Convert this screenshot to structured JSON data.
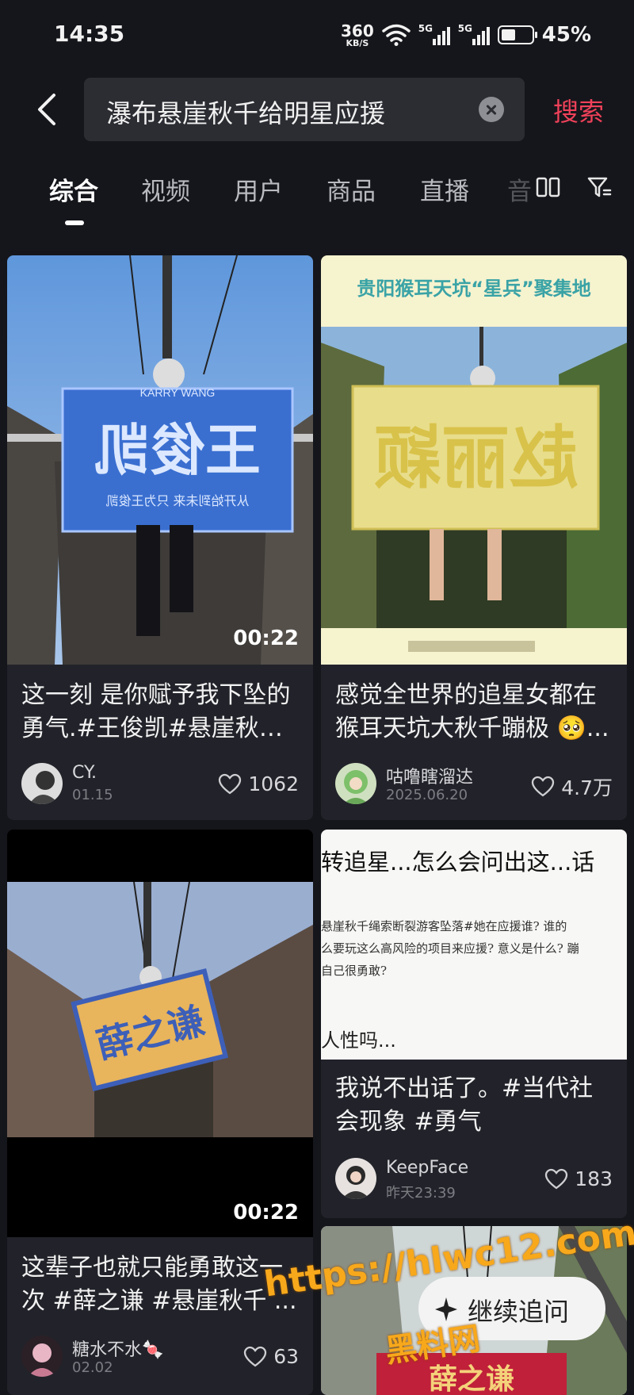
{
  "status_bar": {
    "time": "14:35",
    "net_speed": "360",
    "net_unit": "KB/S",
    "sim1": "5G",
    "sim2": "5G",
    "battery_text": "45%",
    "battery_level": 0.45
  },
  "search": {
    "query": "瀑布悬崖秋千给明星应援",
    "button": "搜索",
    "accent": "#f0415a"
  },
  "tabs": [
    {
      "label": "综合",
      "active": true
    },
    {
      "label": "视频"
    },
    {
      "label": "用户"
    },
    {
      "label": "商品"
    },
    {
      "label": "直播"
    },
    {
      "label": "音"
    }
  ],
  "cards": [
    {
      "thumb_flag_top": "KARRY WANG",
      "thumb_flag_main": "王俊凯",
      "thumb_flag_bottom": "从开始到未来 只为王俊凯",
      "duration": "00:22",
      "title_line1": "这一刻 是你赋予我下坠的",
      "title_line2": "勇气.#王俊凯#悬崖秋千...",
      "author": "CY.",
      "date": "01.15",
      "likes": "1062"
    },
    {
      "thumb_header": "贵阳猴耳天坑“星兵”聚集地",
      "thumb_flag_main": "赵丽颖",
      "title_line1": "感觉全世界的追星女都在",
      "title_line2": "猴耳天坑大秋千蹦极 🥺...",
      "author": "咕噜瞎溜达",
      "date": "2025.06.20",
      "likes": "4.7万"
    },
    {
      "thumb_flag_main": "薛之谦",
      "duration": "00:22",
      "title_line1": "这辈子也就只能勇敢这一",
      "title_line2": "次 #薛之谦 #悬崖秋千 ...",
      "author": "糖水不水🍬",
      "date": "02.02",
      "likes": "63"
    },
    {
      "thumb_heading": "转追星...怎么会问出这...话",
      "thumb_note_1": "悬崖秋千绳索断裂游客坠落#她在应援谁? 谁的",
      "thumb_note_2": "么要玩这么高风险的项目来应援? 意义是什么? 蹦",
      "thumb_note_3": "自己很勇敢?",
      "thumb_footer": "人性吗...",
      "title_line1": "我说不出话了。#当代社",
      "title_line2": "会现象 #勇气",
      "author": "KeepFace",
      "date": "昨天23:39",
      "likes": "183"
    },
    {
      "thumb_flag_main": "薛之谦"
    }
  ],
  "overlay": {
    "follow_up": "继续追问",
    "watermark_url": "https://hlwc12.com",
    "watermark_site": "黑料网"
  }
}
